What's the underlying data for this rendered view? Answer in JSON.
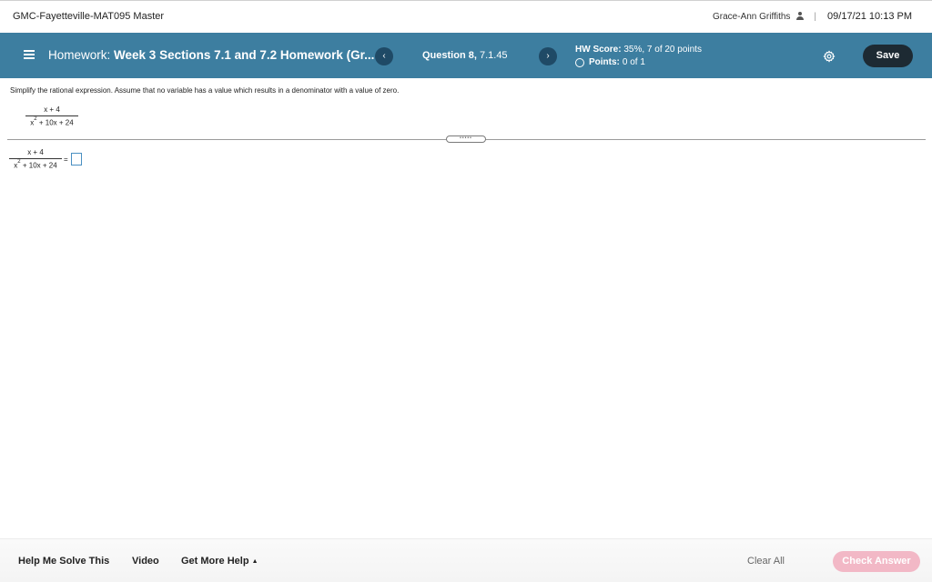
{
  "topbar": {
    "course_title": "GMC-Fayetteville-MAT095 Master",
    "user_name": "Grace-Ann Griffiths",
    "separator": "|",
    "datetime": "09/17/21 10:13 PM"
  },
  "header": {
    "hw_prefix": "Homework:",
    "hw_name": "Week 3 Sections 7.1 and 7.2 Homework (Gr...",
    "prev_label": "‹",
    "next_label": "›",
    "question_bold": "Question 8,",
    "question_id": "7.1.45",
    "hw_score_label": "HW Score:",
    "hw_score_value": "35%, 7 of 20 points",
    "points_label": "Points:",
    "points_value": "0 of 1",
    "save_label": "Save"
  },
  "question": {
    "instruction": "Simplify the rational expression. Assume that no variable has a value which results in a denominator with a value of zero.",
    "numerator": "x + 4",
    "denominator_base": "x",
    "denominator_exp": "2",
    "denominator_rest": "+ 10x + 24",
    "equals": "=",
    "handle_dots": "•••••"
  },
  "footer": {
    "help_me_solve": "Help Me Solve This",
    "video": "Video",
    "get_more_help": "Get More Help",
    "caret": "▲",
    "clear_all": "Clear All",
    "check_answer": "Check Answer"
  },
  "colors": {
    "header_bg": "#3d7ea0",
    "nav_btn_bg": "#1f4a66",
    "save_bg": "#1d2a33",
    "check_answer_bg": "#f2b8c6",
    "answer_box_border": "#4a90c2"
  },
  "icons": {
    "menu": "hamburger-menu-icon",
    "user": "user-icon",
    "points": "circle-icon",
    "settings": "gear-icon"
  }
}
